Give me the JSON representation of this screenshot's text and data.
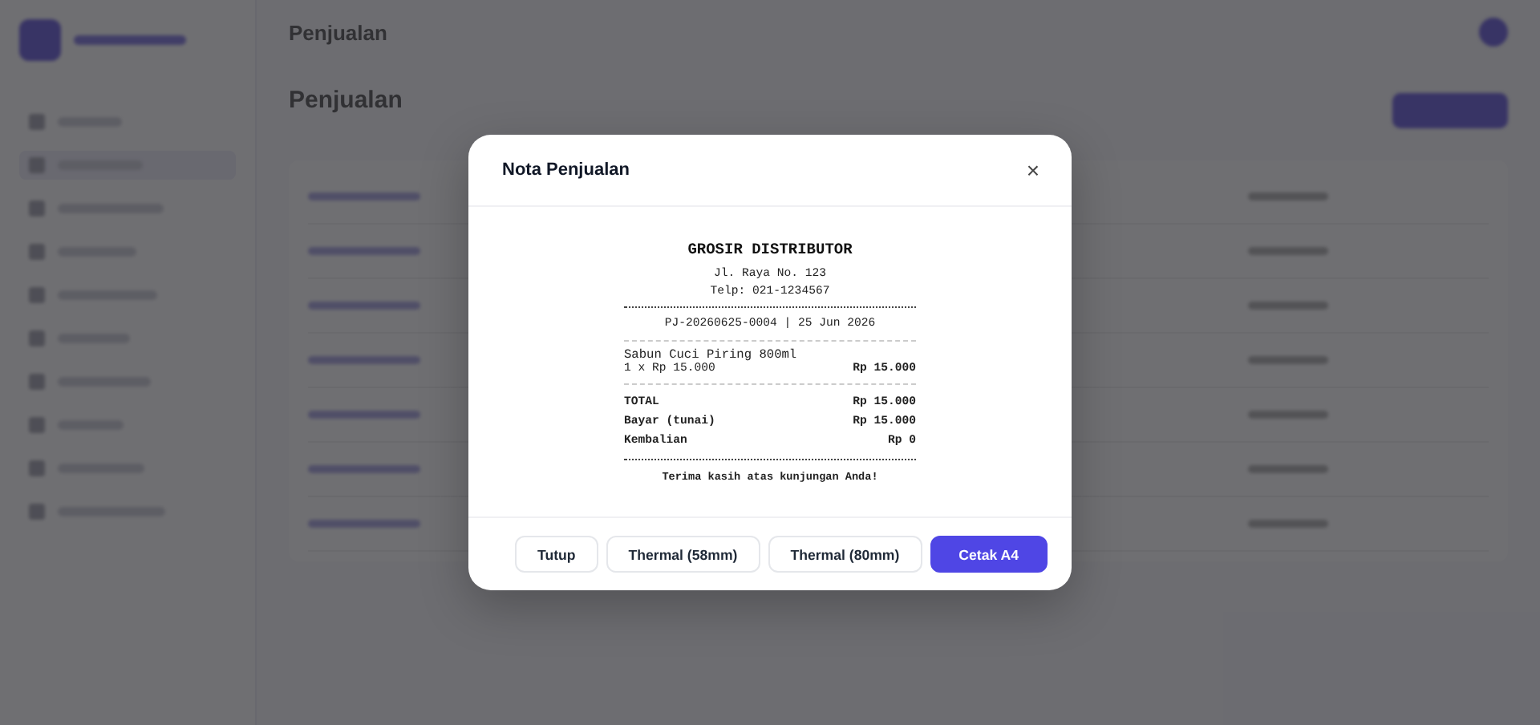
{
  "backdrop": {
    "header_title": "Penjualan",
    "page_title": "Penjualan"
  },
  "modal": {
    "title": "Nota Penjualan",
    "close": "×",
    "receipt": {
      "store": "GROSIR DISTRIBUTOR",
      "address": "Jl. Raya No. 123",
      "phone": "Telp: 021-1234567",
      "ref": "PJ-20260625-0004 | 25 Jun 2026",
      "items": [
        {
          "name": "Sabun Cuci Piring 800ml",
          "qty_price": "1 x Rp 15.000",
          "subtotal": "Rp 15.000"
        }
      ],
      "totals": [
        {
          "label": "TOTAL",
          "value": "Rp 15.000"
        },
        {
          "label": "Bayar (tunai)",
          "value": "Rp 15.000"
        },
        {
          "label": "Kembalian",
          "value": "Rp 0"
        }
      ],
      "thanks": "Terima kasih atas kunjungan Anda!"
    },
    "buttons": [
      {
        "label": "Tutup",
        "kind": "secondary"
      },
      {
        "label": "Thermal (58mm)",
        "kind": "secondary"
      },
      {
        "label": "Thermal (80mm)",
        "kind": "secondary"
      },
      {
        "label": "Cetak A4",
        "kind": "primary"
      }
    ]
  }
}
